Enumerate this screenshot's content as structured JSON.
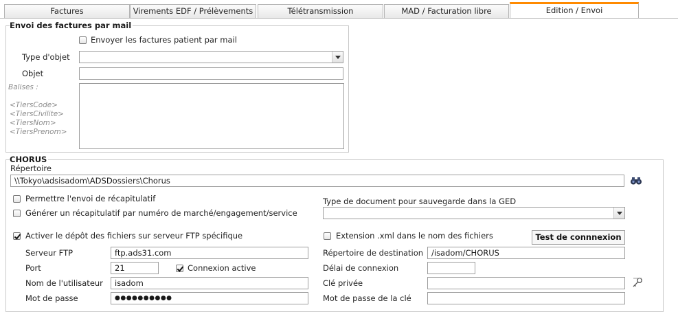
{
  "tabs": {
    "factures": "Factures",
    "virements": "Virements EDF / Prélèvements",
    "teletransmission": "Télétransmission",
    "mad": "MAD / Facturation libre",
    "edition": "Edition / Envoi"
  },
  "mail_section": {
    "title": "Envoi des factures par mail",
    "send_checkbox_label": "Envoyer les factures patient par mail",
    "send_checked": false,
    "object_type_label": "Type d'objet",
    "object_type_value": "",
    "object_label": "Objet",
    "object_value": "",
    "tags_label": "Balises :",
    "tags": [
      "<TiersCode>",
      "<TiersCivilite>",
      "<TiersNom>",
      "<TiersPrenom>"
    ]
  },
  "chorus": {
    "title": "CHORUS",
    "directory_label": "Répertoire",
    "directory_value": "\\\\Tokyo\\adsisadom\\ADSDossiers\\Chorus",
    "allow_summary_label": "Permettre l'envoi de récapitulatif",
    "allow_summary_checked": false,
    "generate_summary_label": "Générer un récapitulatif par numéro de marché/engagement/service",
    "generate_summary_checked": false,
    "doc_type_label": "Type de document pour sauvegarde dans la GED",
    "doc_type_value": "",
    "ftp_enable_label": "Activer le dépôt des fichiers sur serveur FTP spécifique",
    "ftp_enable_checked": true,
    "xml_ext_label": "Extension .xml dans le nom des fichiers",
    "xml_ext_checked": false,
    "test_button_label": "Test de connnexion",
    "ftp_server_label": "Serveur FTP",
    "ftp_server_value": "ftp.ads31.com",
    "port_label": "Port",
    "port_value": "21",
    "active_connection_label": "Connexion active",
    "active_connection_checked": true,
    "username_label": "Nom de l'utilisateur",
    "username_value": "isadom",
    "password_label": "Mot de passe",
    "password_value": "●●●●●●●●●●",
    "dest_dir_label": "Répertoire de destination",
    "dest_dir_value": "/isadom/CHORUS",
    "timeout_label": "Délai de connexion",
    "timeout_value": "",
    "private_key_label": "Clé privée",
    "private_key_value": "",
    "key_password_label": "Mot de passe de la clé",
    "key_password_value": ""
  },
  "icons": [
    "binoculars-icon",
    "key-icon",
    "dropdown-arrow-icon"
  ]
}
